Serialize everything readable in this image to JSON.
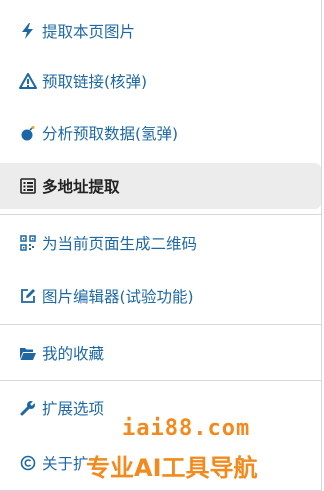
{
  "menu": {
    "items": [
      {
        "label": "提取本页图片",
        "icon": "lightning-bolt-icon"
      },
      {
        "label": "预取链接(核弹)",
        "icon": "warning-triangle-icon"
      },
      {
        "label": "分析预取数据(氢弹)",
        "icon": "bomb-icon"
      },
      {
        "label": "多地址提取",
        "icon": "list-icon",
        "active": true
      },
      {
        "label": "为当前页面生成二维码",
        "icon": "qrcode-icon"
      },
      {
        "label": "图片编辑器(试验功能)",
        "icon": "edit-icon"
      },
      {
        "label": "我的收藏",
        "icon": "folder-open-icon"
      },
      {
        "label": "扩展选项",
        "icon": "wrench-icon"
      },
      {
        "label": "关于扩",
        "icon": "copyright-icon"
      }
    ]
  },
  "watermark": {
    "site": "iai88.com",
    "slogan": "专业AI工具导航"
  },
  "colors": {
    "link": "#1d68a4",
    "active_bg": "#ececec",
    "watermark": "#f28a1d"
  }
}
